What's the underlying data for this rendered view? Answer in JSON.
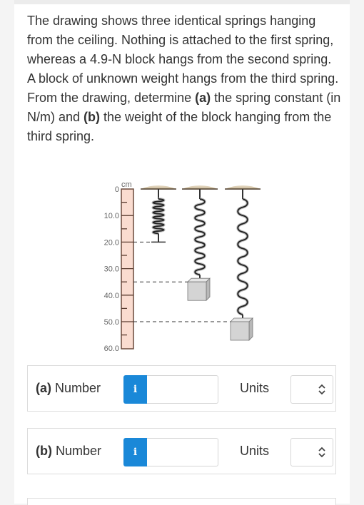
{
  "question": {
    "intro": "The drawing shows three identical springs hanging from the ceiling. Nothing is attached to the first spring, whereas a 4.9-N block hangs from the second spring. A block of unknown weight hangs from the third spring. From the drawing, determine ",
    "part_a_tag": "(a)",
    "part_a_text": " the spring constant (in N/m) and ",
    "part_b_tag": "(b)",
    "part_b_text": " the weight of the block hanging from the third spring."
  },
  "figure": {
    "ruler_unit": "cm",
    "ruler_range_cm": [
      0,
      60
    ],
    "ruler_labels": [
      "0",
      "10.0",
      "20.0",
      "30.0",
      "40.0",
      "50.0",
      "60.0"
    ],
    "ruler_color": "#fadcd0",
    "springs": [
      {
        "name": "spring-1",
        "end_cm": 20.0,
        "block": false
      },
      {
        "name": "spring-2",
        "end_cm": 35.0,
        "block": true,
        "block_weight": "4.9 N"
      },
      {
        "name": "spring-3",
        "end_cm": 50.0,
        "block": true,
        "block_weight": "unknown"
      }
    ]
  },
  "answers": [
    {
      "tag": "(a)",
      "label": " Number",
      "info_icon": "i",
      "value": "",
      "units_label": "Units",
      "units_value": ""
    },
    {
      "tag": "(b)",
      "label": " Number",
      "info_icon": "i",
      "value": "",
      "units_label": "Units",
      "units_value": ""
    }
  ],
  "colors": {
    "accent": "#1a88d8",
    "text": "#333333",
    "border": "#dcdcdc"
  }
}
